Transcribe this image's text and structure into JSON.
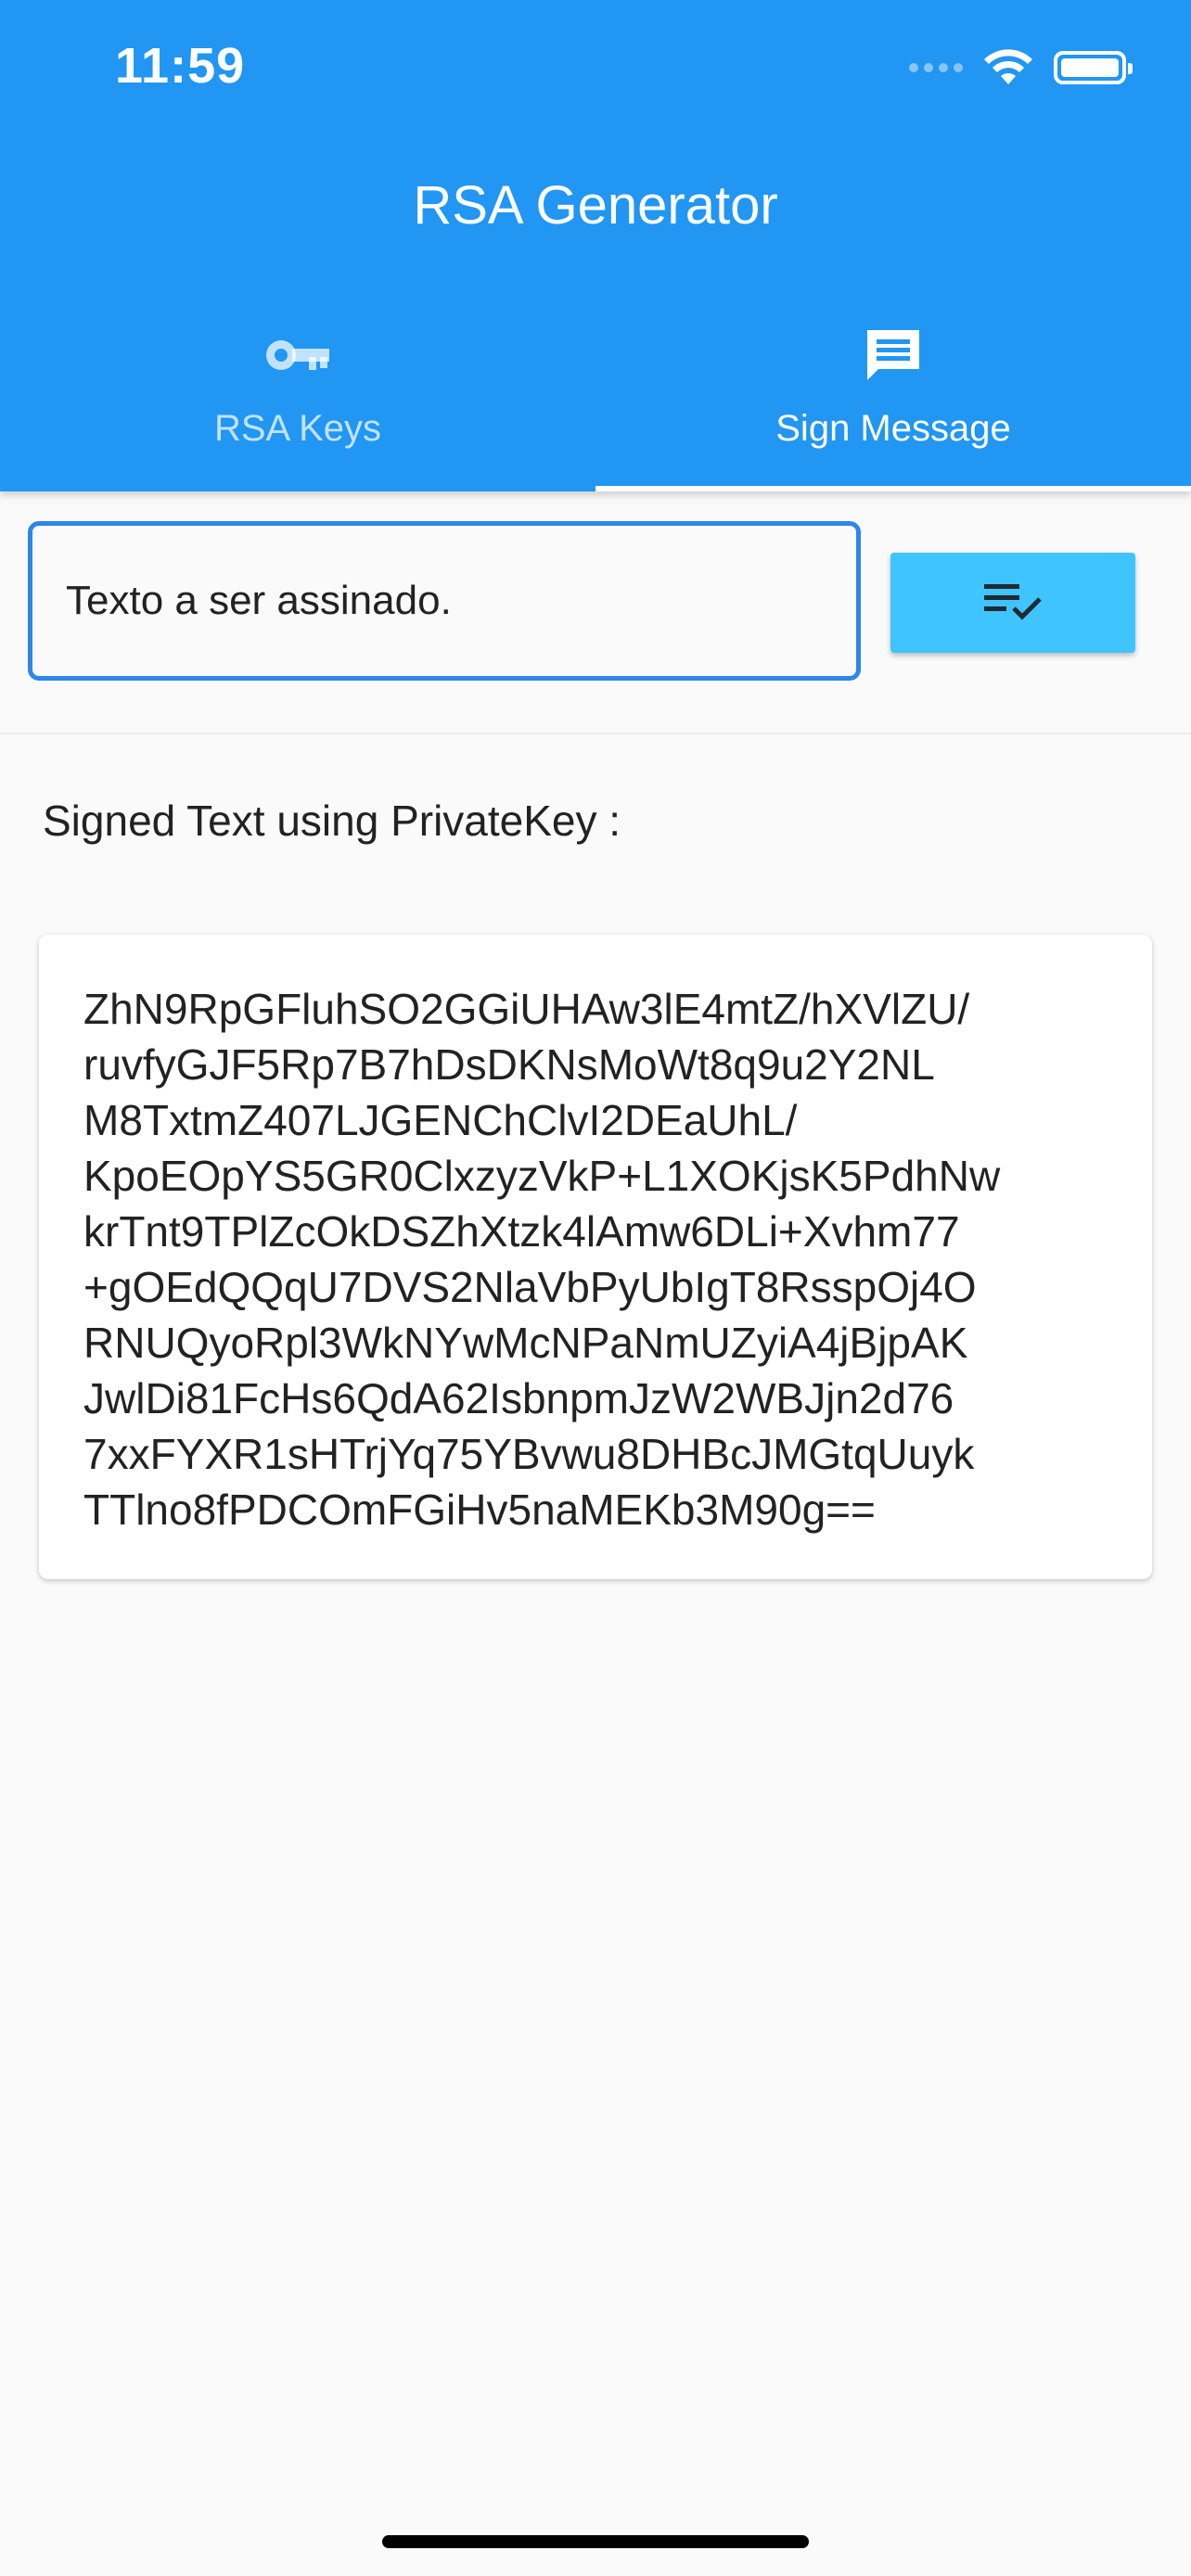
{
  "status_bar": {
    "time": "11:59",
    "icons": [
      "cellular-signal-icon",
      "wifi-icon",
      "battery-icon"
    ]
  },
  "app_bar": {
    "title": "RSA Generator",
    "background_color": "#2196f3"
  },
  "tabs": [
    {
      "label": "RSA Keys",
      "icon": "key-icon",
      "selected": false
    },
    {
      "label": "Sign Message",
      "icon": "message-icon",
      "selected": true
    }
  ],
  "message_input": {
    "value": "Texto a ser assinado.",
    "border_color": "#2f86ea"
  },
  "sign_button": {
    "icon": "playlist-check-icon",
    "color": "#40c4ff"
  },
  "result": {
    "label": "Signed Text using PrivateKey :",
    "signature_lines": [
      "ZhN9RpGFluhSO2GGiUHAw3lE4mtZ/hXVlZU/",
      "ruvfyGJF5Rp7B7hDsDKNsMoWt8q9u2Y2NL",
      "M8TxtmZ407LJGENChClvI2DEaUhL/",
      "KpoEOpYS5GR0ClxzyzVkP+L1XOKjsK5PdhNw",
      "krTnt9TPlZcOkDSZhXtzk4lAmw6DLi+Xvhm77",
      "+gOEdQQqU7DVS2NlaVbPyUbIgT8RsspOj4O",
      "RNUQyoRpl3WkNYwMcNPaNmUZyiA4jBjpAK",
      "JwlDi81FcHs6QdA62IsbnpmJzW2WBJjn2d76",
      "7xxFYXR1sHTrjYq75YBvwu8DHBcJMGtqUuyk",
      "TTlno8fPDCOmFGiHv5naMEKb3M90g=="
    ]
  }
}
